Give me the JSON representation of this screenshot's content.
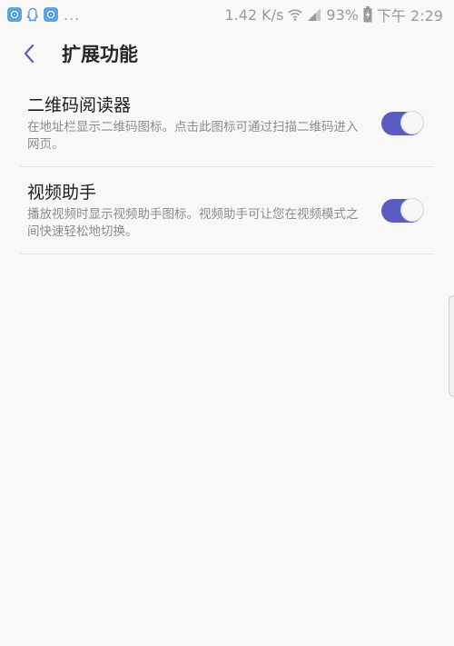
{
  "status_bar": {
    "notification_icons": [
      "app-notification-icon",
      "qq-icon",
      "app-notification-icon"
    ],
    "more_indicator": "...",
    "network_speed": "1.42 K/s",
    "battery_percent": "93%",
    "time": "下午 2:29"
  },
  "header": {
    "back_icon": "chevron-left-icon",
    "title": "扩展功能"
  },
  "settings": [
    {
      "title": "二维码阅读器",
      "description": "在地址栏显示二维码图标。点击此图标可通过扫描二维码进入网页。",
      "enabled": true
    },
    {
      "title": "视频助手",
      "description": "播放视频时显示视频助手图标。视频助手可让您在视频模式之间快速轻松地切换。",
      "enabled": true
    }
  ],
  "colors": {
    "accent": "#5a5cc2",
    "background": "#f8f8f8",
    "secondary_text": "#8c8c8c",
    "divider": "#e3e3e3"
  }
}
